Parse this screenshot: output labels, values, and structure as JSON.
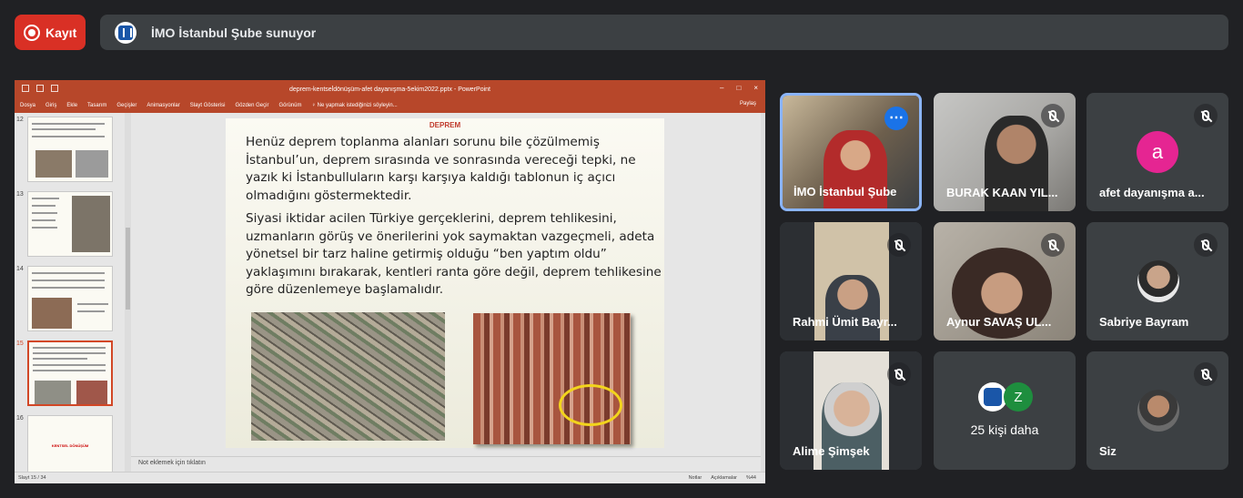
{
  "topbar": {
    "record_label": "Kayıt",
    "presenter_text": "İMO İstanbul Şube sunuyor"
  },
  "ppt": {
    "window_title": "deprem-kentsel̇dönüşüm-afet dayanışma-5ekim2022.pptx - PowerPoint",
    "menu": [
      "Dosya",
      "Giriş",
      "Ekle",
      "Tasarım",
      "Geçişler",
      "Animasyonlar",
      "Slayt Gösterisi",
      "Gözden Geçir",
      "Görünüm",
      "♀ Ne yapmak istediğinizi söyleyin..."
    ],
    "share_label": "Paylaş",
    "thumb_numbers": [
      "12",
      "13",
      "14",
      "15",
      "16"
    ],
    "thumb16_label": "KENTSEL DÖNÜŞÜM",
    "slide_title": "DEPREM",
    "paragraph1": "Henüz deprem toplanma alanları sorunu bile çözülmemiş İstanbul’un, deprem sırasında ve sonrasında vereceği tepki, ne yazık ki İstanbulluların karşı karşıya kaldığı tablonun iç açıcı olmadığını göstermektedir.",
    "paragraph2": "Siyasi iktidar acilen Türkiye gerçeklerini, deprem tehlikesini, uzmanların görüş ve önerilerini yok saymaktan vazgeçmeli, adeta yönetsel bir tarz haline getirmiş olduğu “ben yaptım oldu” yaklaşımını bırakarak, kentleri ranta göre değil, deprem tehlikesine göre düzenlemeye başlamalıdır.",
    "notes_placeholder": "Not eklemek için tıklatın",
    "status_slide": "Slayt 15 / 34",
    "status_notes": "Notlar",
    "status_comments": "Açıklamalar",
    "status_zoom": "%44"
  },
  "participants": [
    {
      "name": "İMO İstanbul Şube",
      "active": true
    },
    {
      "name": "BURAK KAAN YIL..."
    },
    {
      "name": "afet dayanışma a...",
      "avatar_letter": "a"
    },
    {
      "name": "Rahmi Ümit Bayr..."
    },
    {
      "name": "Aynur SAVAŞ UL..."
    },
    {
      "name": "Sabriye Bayram"
    },
    {
      "name": "Alime Şimşek"
    },
    {
      "name": "25 kişi daha",
      "extra_avatar_letter": "Z"
    },
    {
      "name": "Siz"
    }
  ],
  "colors": {
    "record": "#d93025",
    "tile": "#3c4043",
    "active_border": "#8ab4f8",
    "ppt_accent": "#b7472a"
  }
}
